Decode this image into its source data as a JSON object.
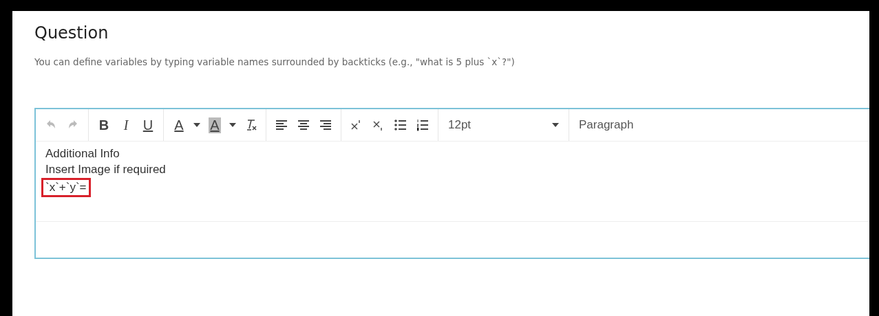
{
  "title": "Question",
  "description": "You can define variables by typing variable names surrounded by backticks (e.g., \"what is 5 plus `x`?\")",
  "editor": {
    "toolbar": [
      {
        "group": [
          {
            "kind": "undo",
            "disabled": true
          },
          {
            "kind": "redo",
            "disabled": true
          }
        ]
      },
      {
        "group": [
          {
            "kind": "bold",
            "glyph": "B",
            "disabled": false
          },
          {
            "kind": "italic",
            "glyph": "I",
            "disabled": false
          },
          {
            "kind": "underline",
            "glyph": "U",
            "disabled": false
          }
        ]
      },
      {
        "group": [
          {
            "kind": "text-color",
            "glyph": "A",
            "disabled": false
          },
          {
            "kind": "caret",
            "disabled": false
          },
          {
            "kind": "highlight-color",
            "glyph": "A",
            "disabled": false
          },
          {
            "kind": "caret",
            "disabled": false
          },
          {
            "kind": "clear-format",
            "disabled": false
          }
        ]
      },
      {
        "group": [
          {
            "kind": "align-left",
            "disabled": false
          },
          {
            "kind": "align-center",
            "disabled": false
          },
          {
            "kind": "align-right",
            "disabled": false
          }
        ]
      },
      {
        "group": [
          {
            "kind": "superscript",
            "disabled": false
          },
          {
            "kind": "subscript",
            "disabled": false
          },
          {
            "kind": "bullet-list",
            "disabled": false
          },
          {
            "kind": "numbered-list",
            "disabled": false
          }
        ]
      }
    ],
    "font_size": "12pt",
    "block_format": "Paragraph",
    "lines": [
      {
        "text": "Additional Info",
        "highlighted": false
      },
      {
        "text": "Insert Image if required",
        "highlighted": false
      },
      {
        "text": "`x`+`y`=",
        "highlighted": true
      }
    ]
  }
}
